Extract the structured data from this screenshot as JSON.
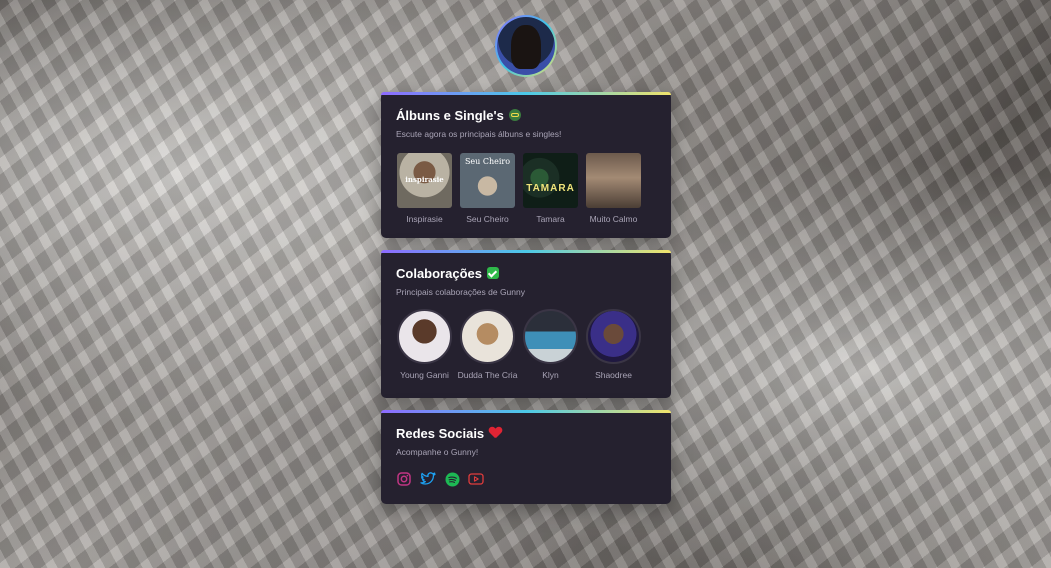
{
  "colors": {
    "card_bg": "#25212f",
    "accent_gradient": [
      "#8e6bff",
      "#4cc9e8",
      "#f1e36b"
    ],
    "instagram": "#c13584",
    "twitter": "#1da1f2",
    "spotify": "#1db954",
    "youtube": "#e03c3c"
  },
  "albums_card": {
    "title": "Álbuns e Single's",
    "title_icon": "loop-arrows-icon",
    "subtitle": "Escute agora os principais álbuns e singles!",
    "items": [
      {
        "label": "Inspirasie",
        "cover_text": "inspirasie"
      },
      {
        "label": "Seu Cheiro",
        "cover_text": "Seu Cheiro"
      },
      {
        "label": "Tamara",
        "cover_text": "TAMARA"
      },
      {
        "label": "Muito Calmo",
        "cover_text": ""
      }
    ]
  },
  "collabs_card": {
    "title": "Colaborações",
    "title_icon": "check-mark-icon",
    "subtitle": "Principais colaborações de Gunny",
    "items": [
      {
        "label": "Young Ganni"
      },
      {
        "label": "Dudda The Cria"
      },
      {
        "label": "Klyn"
      },
      {
        "label": "Shaodree"
      }
    ]
  },
  "socials_card": {
    "title": "Redes Sociais",
    "title_icon": "heart-icon",
    "subtitle": "Acompanhe o Gunny!",
    "links": [
      "instagram-icon",
      "twitter-icon",
      "spotify-icon",
      "youtube-icon"
    ]
  }
}
